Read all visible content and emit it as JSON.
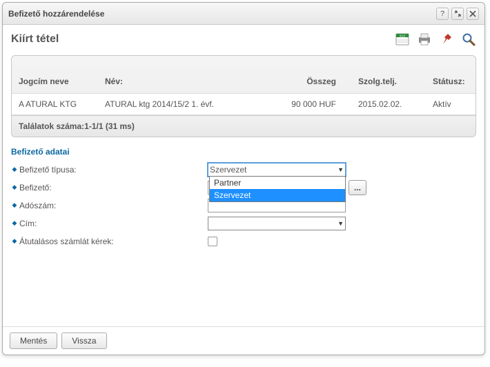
{
  "dialog": {
    "title": "Befizető hozzárendelése"
  },
  "section": {
    "title": "Kiírt tétel"
  },
  "table": {
    "headers": {
      "jogcim": "Jogcím neve",
      "nev": "Név:",
      "osszeg": "Összeg",
      "szolg": "Szolg.telj.",
      "statusz": "Státusz:"
    },
    "row": {
      "jogcim": "A ATURAL KTG",
      "nev": "ATURAL ktg 2014/15/2 1. évf.",
      "osszeg": "90 000 HUF",
      "szolg": "2015.02.02.",
      "statusz": "Aktív"
    },
    "results": "Találatok száma:1-1/1 (31 ms)"
  },
  "form": {
    "title": "Befizető adatai",
    "labels": {
      "tipus": "Befizető típusa:",
      "befizeto": "Befizető:",
      "adoszam": "Adószám:",
      "cim": "Cím:",
      "atutalas": "Átutalásos számlát kérek:"
    },
    "tipus_value": "Szervezet",
    "tipus_options": {
      "opt0": "Partner",
      "opt1": "Szervezet"
    },
    "ellipsis": "..."
  },
  "buttons": {
    "save": "Mentés",
    "back": "Vissza"
  }
}
